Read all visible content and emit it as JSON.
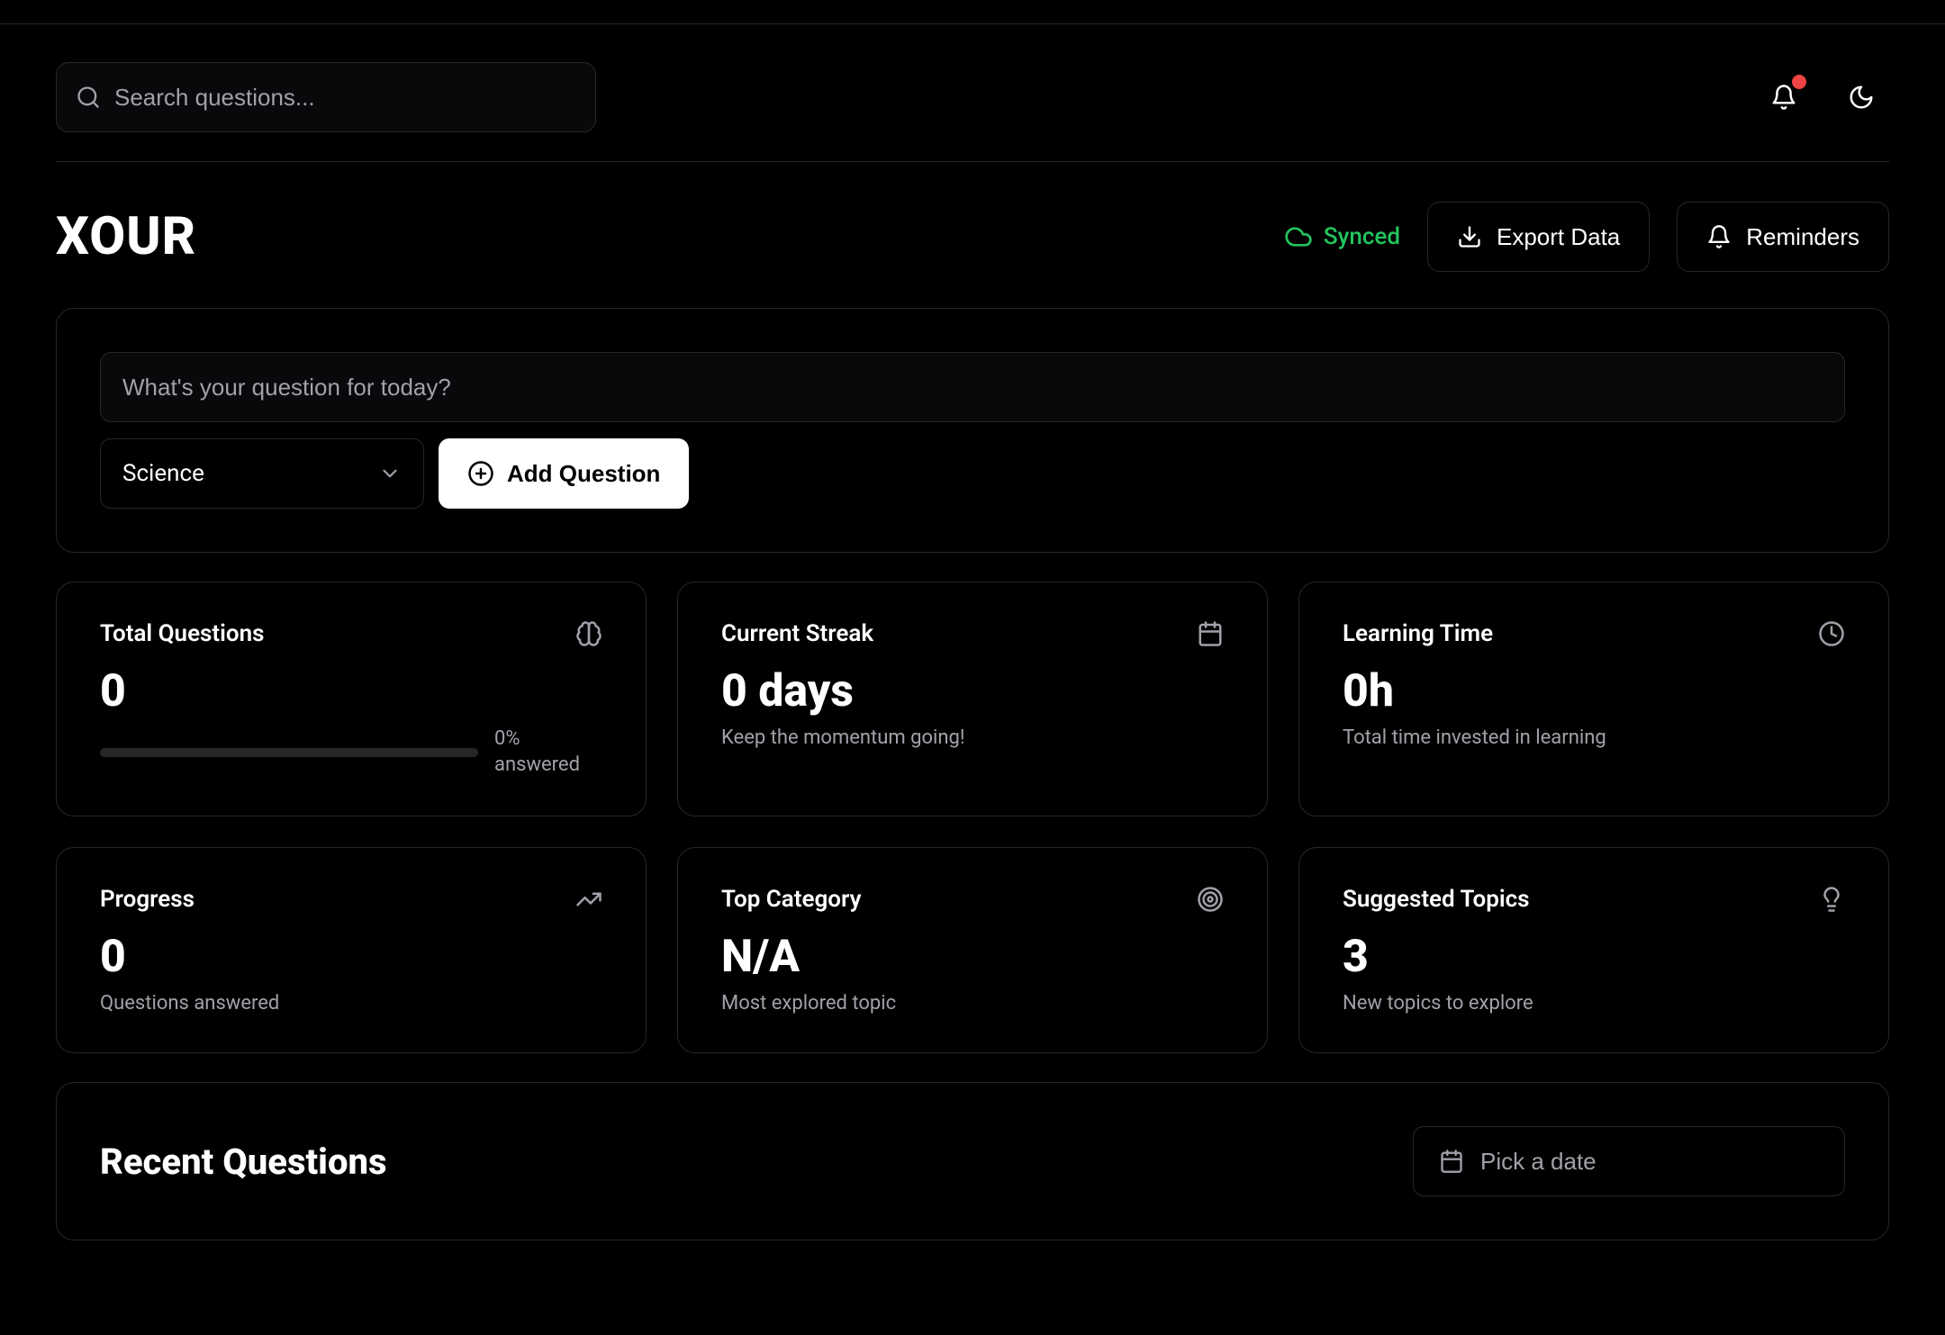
{
  "search": {
    "placeholder": "Search questions..."
  },
  "header": {
    "logo": "XOUR",
    "sync_label": "Synced",
    "export_label": "Export Data",
    "reminders_label": "Reminders"
  },
  "question_panel": {
    "input_placeholder": "What's your question for today?",
    "category_selected": "Science",
    "add_button": "Add Question"
  },
  "cards": {
    "total_questions": {
      "title": "Total Questions",
      "value": "0",
      "progress_pct": "0%",
      "progress_label": "answered"
    },
    "current_streak": {
      "title": "Current Streak",
      "value": "0 days",
      "sub": "Keep the momentum going!"
    },
    "learning_time": {
      "title": "Learning Time",
      "value": "0h",
      "sub": "Total time invested in learning"
    },
    "progress": {
      "title": "Progress",
      "value": "0",
      "sub": "Questions answered"
    },
    "top_category": {
      "title": "Top Category",
      "value": "N/A",
      "sub": "Most explored topic"
    },
    "suggested": {
      "title": "Suggested Topics",
      "value": "3",
      "sub": "New topics to explore"
    }
  },
  "recent": {
    "title": "Recent Questions",
    "date_placeholder": "Pick a date"
  }
}
